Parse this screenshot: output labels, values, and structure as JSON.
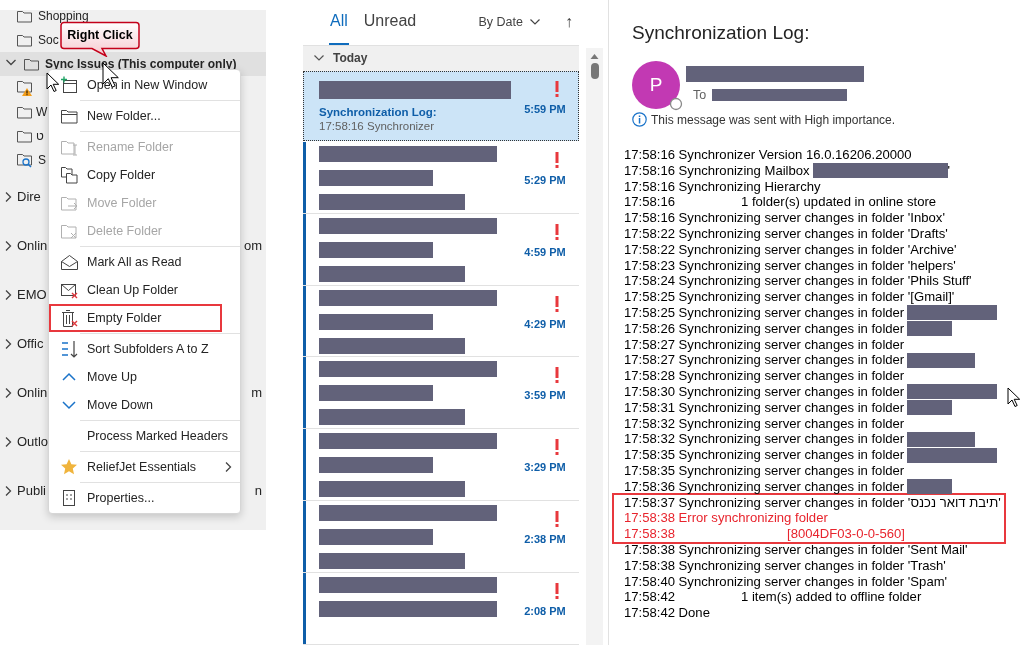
{
  "folder_pane": {
    "folders": [
      {
        "label": "Shopping",
        "kind": "folder",
        "selected": false
      },
      {
        "label": "Soc",
        "kind": "folder",
        "selected": false
      },
      {
        "label": "Sync Issues (This computer only)",
        "kind": "folder",
        "selected": true,
        "expanded": true,
        "children": [
          {
            "kind": "warning-folder",
            "selected": false
          },
          {
            "label": "W",
            "kind": "folder",
            "selected": false
          },
          {
            "label": "ט",
            "kind": "folder",
            "selected": false
          },
          {
            "label": "S",
            "kind": "search-folder",
            "selected": false
          }
        ]
      }
    ],
    "accounts": [
      {
        "label": "Dire",
        "expanded": false
      },
      {
        "label": "Onlin",
        "tail": "om",
        "expanded": false
      },
      {
        "label": "EMO",
        "expanded": false
      },
      {
        "label": "Offic",
        "expanded": false
      },
      {
        "label": "Onlin",
        "tail": "m",
        "expanded": false
      },
      {
        "label": "Outlo",
        "expanded": false
      },
      {
        "label": "Publi",
        "tail": "n",
        "expanded": false
      }
    ]
  },
  "callout": {
    "text": "Right Click"
  },
  "context_menu": {
    "items": [
      {
        "label": "Open in New Window",
        "disabled": false,
        "highlighted": false,
        "separator_above": false,
        "submenu": false
      },
      {
        "label": "New Folder...",
        "disabled": false,
        "highlighted": false,
        "separator_above": true,
        "submenu": false
      },
      {
        "label": "Rename Folder",
        "disabled": true,
        "highlighted": false,
        "separator_above": true,
        "submenu": false
      },
      {
        "label": "Copy Folder",
        "disabled": false,
        "highlighted": false,
        "separator_above": false,
        "submenu": false
      },
      {
        "label": "Move Folder",
        "disabled": true,
        "highlighted": false,
        "separator_above": false,
        "submenu": false
      },
      {
        "label": "Delete Folder",
        "disabled": true,
        "highlighted": false,
        "separator_above": false,
        "submenu": false
      },
      {
        "label": "Mark All as Read",
        "disabled": false,
        "highlighted": false,
        "separator_above": true,
        "submenu": false
      },
      {
        "label": "Clean Up Folder",
        "disabled": false,
        "highlighted": false,
        "separator_above": false,
        "submenu": false
      },
      {
        "label": "Empty Folder",
        "disabled": false,
        "highlighted": true,
        "separator_above": false,
        "submenu": false
      },
      {
        "label": "Sort Subfolders A to Z",
        "disabled": false,
        "highlighted": false,
        "separator_above": true,
        "submenu": false
      },
      {
        "label": "Move Up",
        "disabled": false,
        "highlighted": false,
        "separator_above": false,
        "submenu": false
      },
      {
        "label": "Move Down",
        "disabled": false,
        "highlighted": false,
        "separator_above": false,
        "submenu": false
      },
      {
        "label": "Process Marked Headers",
        "disabled": false,
        "highlighted": false,
        "separator_above": true,
        "submenu": false
      },
      {
        "label": "ReliefJet Essentials",
        "disabled": false,
        "highlighted": false,
        "separator_above": true,
        "submenu": true
      },
      {
        "label": "Properties...",
        "disabled": false,
        "highlighted": false,
        "separator_above": true,
        "submenu": false
      }
    ]
  },
  "message_list": {
    "tabs": [
      {
        "label": "All",
        "selected": true
      },
      {
        "label": "Unread",
        "selected": false
      }
    ],
    "sort": "By Date",
    "sort_direction": "↑",
    "group": {
      "label": "Today",
      "expanded": true
    },
    "messages": [
      {
        "selected": true,
        "unread": false,
        "high_importance": true,
        "time": "5:59 PM",
        "redacted_sender": true,
        "subject": "Synchronization Log:",
        "preview": "17:58:16 Synchronizer"
      },
      {
        "selected": false,
        "unread": true,
        "high_importance": true,
        "time": "5:29 PM",
        "redacted_sender": true,
        "redacted_subject": true,
        "redacted_preview": true
      },
      {
        "selected": false,
        "unread": true,
        "high_importance": true,
        "time": "4:59 PM",
        "redacted_sender": true,
        "redacted_subject": true,
        "redacted_preview": true
      },
      {
        "selected": false,
        "unread": true,
        "high_importance": true,
        "time": "4:29 PM",
        "redacted_sender": true,
        "redacted_subject": true,
        "redacted_preview": true
      },
      {
        "selected": false,
        "unread": true,
        "high_importance": true,
        "time": "3:59 PM",
        "redacted_sender": true,
        "redacted_subject": true,
        "redacted_preview": true
      },
      {
        "selected": false,
        "unread": true,
        "high_importance": true,
        "time": "3:29 PM",
        "redacted_sender": true,
        "redacted_subject": true,
        "redacted_preview": true
      },
      {
        "selected": false,
        "unread": true,
        "high_importance": true,
        "time": "2:38 PM",
        "redacted_sender": true,
        "redacted_subject": true,
        "redacted_preview": true
      },
      {
        "selected": false,
        "unread": true,
        "high_importance": true,
        "time": "2:08 PM",
        "redacted_sender": true,
        "redacted_subject": true,
        "redacted_preview": false
      }
    ]
  },
  "reading_pane": {
    "subject": "Synchronization Log:",
    "avatar": "P",
    "to_label": "To",
    "notice": "This message was sent with High importance.",
    "log": [
      {
        "kind": "entry",
        "text": "17:58:16 Synchronizer Version 16.0.16206.20000",
        "highlighted": false
      },
      {
        "kind": "entry",
        "text": "17:58:16 Synchronizing Mailbox",
        "redacted": true,
        "after": "'",
        "highlighted": false
      },
      {
        "kind": "entry",
        "text": "17:58:16 Synchronizing Hierarchy",
        "highlighted": false
      },
      {
        "kind": "detail",
        "time": "17:58:16",
        "text": "1 folder(s) updated in online store",
        "highlighted": false
      },
      {
        "kind": "entry",
        "text": "17:58:16 Synchronizing server changes in folder 'Inbox'",
        "highlighted": false
      },
      {
        "kind": "entry",
        "text": "17:58:22 Synchronizing server changes in folder 'Drafts'",
        "highlighted": false
      },
      {
        "kind": "entry",
        "text": "17:58:22 Synchronizing server changes in folder 'Archive'",
        "highlighted": false
      },
      {
        "kind": "entry",
        "text": "17:58:23 Synchronizing server changes in folder 'helpers'",
        "highlighted": false
      },
      {
        "kind": "entry",
        "text": "17:58:24 Synchronizing server changes in folder 'Phils Stuff'",
        "highlighted": false
      },
      {
        "kind": "entry",
        "text": "17:58:25 Synchronizing server changes in folder '[Gmail]'",
        "highlighted": false
      },
      {
        "kind": "entry",
        "text": "17:58:25 Synchronizing server changes in folder",
        "redacted": true,
        "highlighted": false
      },
      {
        "kind": "entry",
        "text": "17:58:26 Synchronizing server changes in folder",
        "redacted": true,
        "highlighted": false
      },
      {
        "kind": "entry",
        "text": "17:58:27 Synchronizing server changes in folder",
        "highlighted": false
      },
      {
        "kind": "entry",
        "text": "17:58:27 Synchronizing server changes in folder",
        "redacted": true,
        "highlighted": false
      },
      {
        "kind": "entry",
        "text": "17:58:28 Synchronizing server changes in folder",
        "highlighted": false
      },
      {
        "kind": "entry",
        "text": "17:58:30 Synchronizing server changes in folder",
        "redacted": true,
        "highlighted": false
      },
      {
        "kind": "entry",
        "text": "17:58:31 Synchronizing server changes in folder",
        "redacted": true,
        "highlighted": false
      },
      {
        "kind": "entry",
        "text": "17:58:32 Synchronizing server changes in folder",
        "highlighted": false
      },
      {
        "kind": "entry",
        "text": "17:58:32 Synchronizing server changes in folder",
        "redacted": true,
        "highlighted": false
      },
      {
        "kind": "entry",
        "text": "17:58:35 Synchronizing server changes in folder",
        "redacted": true,
        "highlighted": false
      },
      {
        "kind": "entry",
        "text": "17:58:35 Synchronizing server changes in folder",
        "highlighted": false
      },
      {
        "kind": "entry",
        "text": "17:58:36 Synchronizing server changes in folder",
        "redacted": true,
        "highlighted": false
      },
      {
        "kind": "entry",
        "text": "17:58:37 Synchronizing server changes in folder 'תיבת דואר נכנס'",
        "highlighted": true
      },
      {
        "kind": "error",
        "text": "17:58:38 Error synchronizing folder",
        "highlighted": true
      },
      {
        "kind": "error-detail",
        "time": "17:58:38",
        "text": "[8004DF03-0-0-560]",
        "highlighted": true
      },
      {
        "kind": "entry",
        "text": "17:58:38 Synchronizing server changes in folder 'Sent Mail'",
        "highlighted": false
      },
      {
        "kind": "entry",
        "text": "17:58:38 Synchronizing server changes in folder 'Trash'",
        "highlighted": false
      },
      {
        "kind": "entry",
        "text": "17:58:40 Synchronizing server changes in folder 'Spam'",
        "highlighted": false
      },
      {
        "kind": "detail",
        "time": "17:58:42",
        "text": "1 item(s) added to offline folder",
        "highlighted": false
      },
      {
        "kind": "entry",
        "text": "17:58:42 Done",
        "highlighted": false
      }
    ]
  }
}
